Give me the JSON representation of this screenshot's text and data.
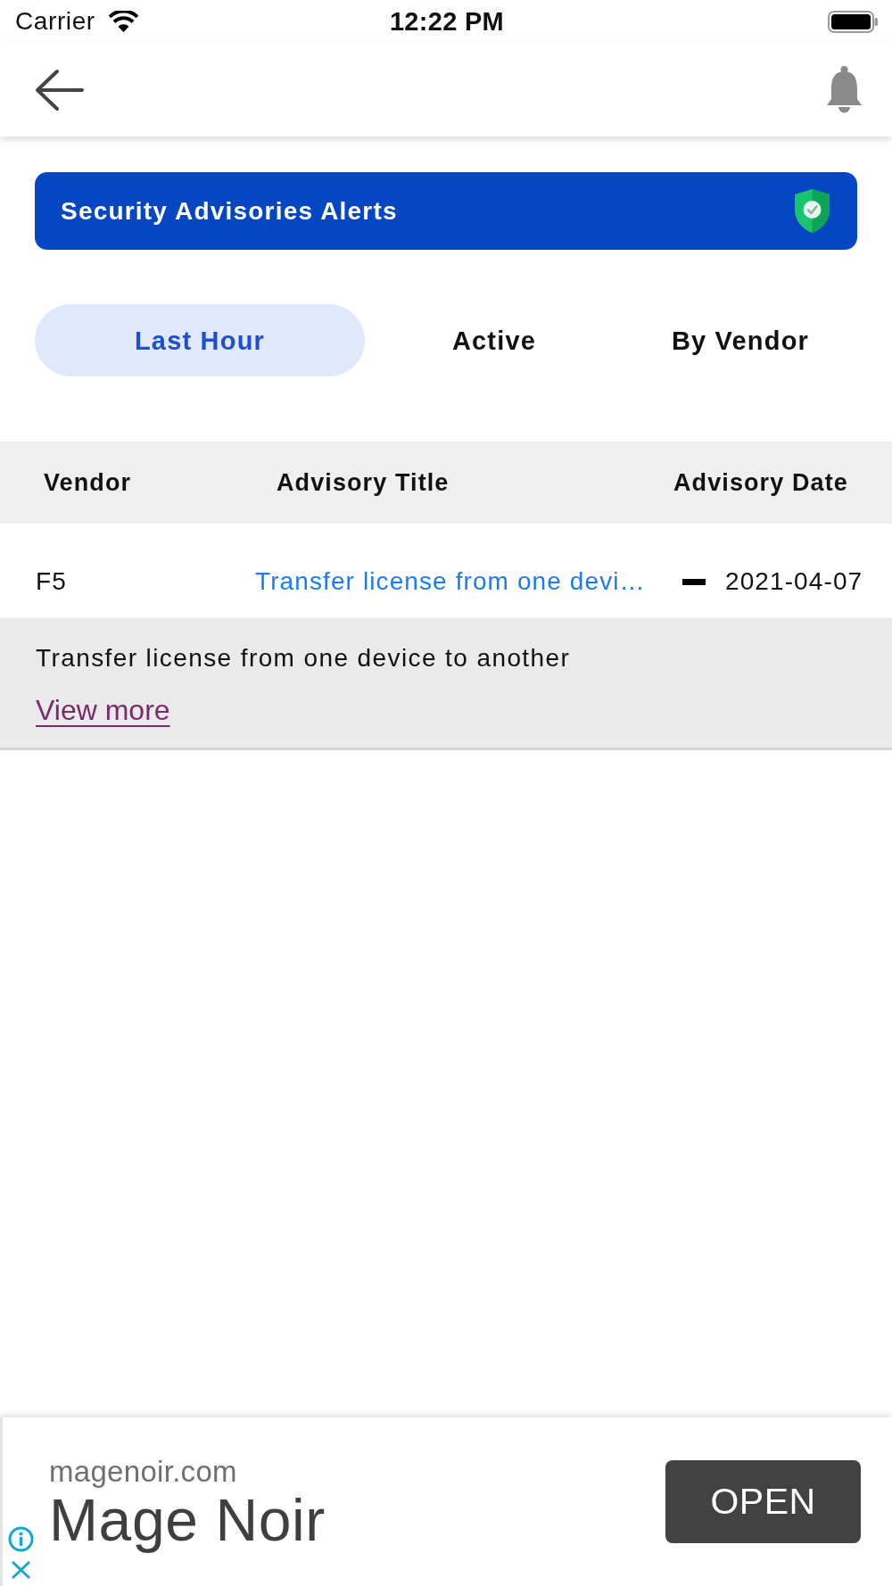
{
  "status_bar": {
    "carrier": "Carrier",
    "time": "12:22 PM"
  },
  "banner": {
    "title": "Security Advisories Alerts"
  },
  "tabs": [
    {
      "label": "Last Hour",
      "selected": true
    },
    {
      "label": "Active",
      "selected": false
    },
    {
      "label": "By Vendor",
      "selected": false
    }
  ],
  "table": {
    "columns": [
      "Vendor",
      "Advisory Title",
      "Advisory Date"
    ],
    "rows": [
      {
        "vendor": "F5",
        "title": "Transfer license from one devi…",
        "date": "2021-04-07",
        "expanded": true,
        "description": "Transfer license from one device to another",
        "link": "View more"
      }
    ]
  },
  "ad": {
    "domain": "magenoir.com",
    "title": "Mage Noir",
    "button": "OPEN"
  }
}
